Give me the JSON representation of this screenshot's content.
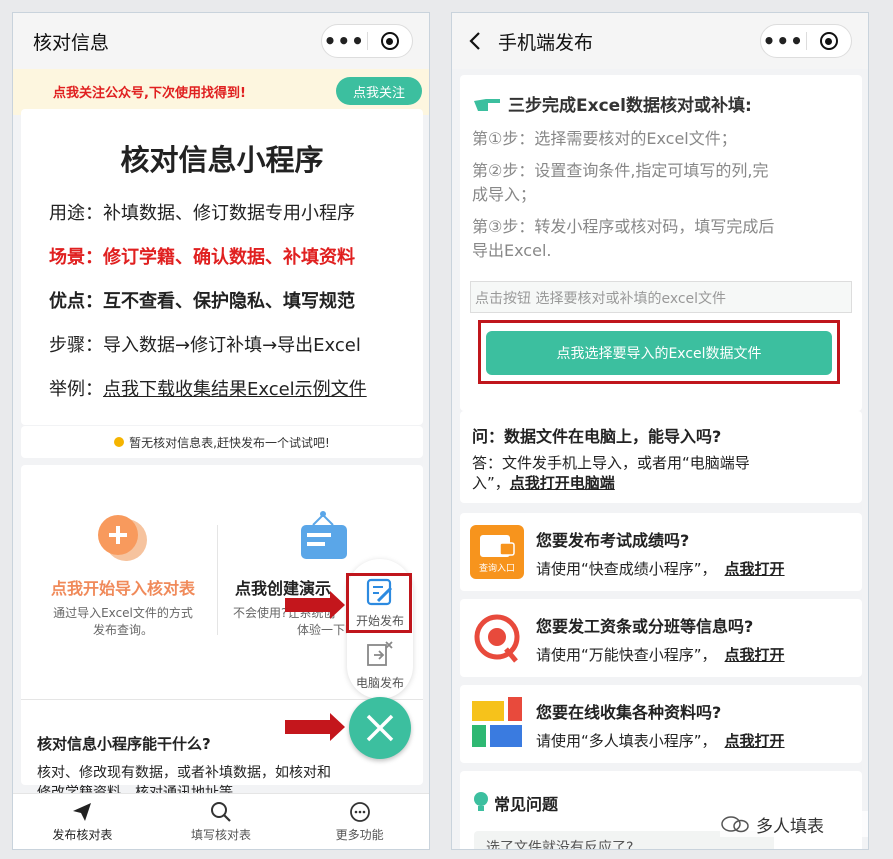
{
  "left": {
    "title": "核对信息",
    "banner": {
      "text": "点我关注公众号,下次使用找得到!",
      "button": "点我关注"
    },
    "intro": {
      "heading": "核对信息小程序",
      "usage_label": "用途：",
      "usage": "补填数据、修订数据专用小程序",
      "scene_label": "场景：",
      "scene": "修订学籍、确认数据、补填资料",
      "merit_label": "优点：",
      "merit": "互不查看、保护隐私、填写规范",
      "steps_label": "步骤：",
      "steps": "导入数据→修订补填→导出Excel",
      "example_label": "举例：",
      "example": "点我下载收集结果Excel示例文件"
    },
    "notice": "暂无核对信息表,赶快发布一个试试吧!",
    "import_title": "点我开始导入核对表",
    "import_desc1": "通过导入Excel文件的方式",
    "import_desc2": "发布查询。",
    "demo_title": "点我创建演示",
    "demo_desc1": "不会使用?让系统创",
    "demo_desc2": "体验一下吧",
    "fab": {
      "start": "开始发布",
      "pc": "电脑发布"
    },
    "faq_title": "核对信息小程序能干什么?",
    "faq_body1": "核对、修改现有数据，或者补填数据，如核对和",
    "faq_body2": "修改学籍资料，核对通讯地址等。",
    "tabs": [
      "发布核对表",
      "填写核对表",
      "更多功能"
    ]
  },
  "right": {
    "title": "手机端发布",
    "steps_heading": "三步完成Excel数据核对或补填:",
    "step1": "第①步：选择需要核对的Excel文件；",
    "step2a": "第②步：设置查询条件,指定可填写的列,完",
    "step2b": "成导入；",
    "step3a": "第③步：转发小程序或核对码，填写完成后",
    "step3b": "导出Excel.",
    "file_placeholder": "点击按钮 选择要核对或补填的excel文件",
    "select_button": "点我选择要导入的Excel数据文件",
    "qa_q": "问：数据文件在电脑上，能导入吗?",
    "qa_a1": "答：文件发手机上导入，或者用“电脑端导",
    "qa_a2": "入”，",
    "qa_link": "点我打开电脑端",
    "promos": [
      {
        "title": "您要发布考试成绩吗?",
        "text": "请使用“快查成绩小程序”，",
        "link": "点我打开",
        "icon_text": "查询入口"
      },
      {
        "title": "您要发工资条或分班等信息吗?",
        "text": "请使用“万能快查小程序”，",
        "link": "点我打开"
      },
      {
        "title": "您要在线收集各种资料吗?",
        "text": "请使用“多人填表小程序”，",
        "link": "点我打开"
      }
    ],
    "common_q": "常见问题",
    "common_q_item": "选了文件就没有反应了?",
    "watermark": "多人填表"
  },
  "colors": {
    "accent": "#3cbf9f",
    "red": "#e02020",
    "highlight": "#c0161c",
    "banner_bg": "#fdf6df"
  }
}
